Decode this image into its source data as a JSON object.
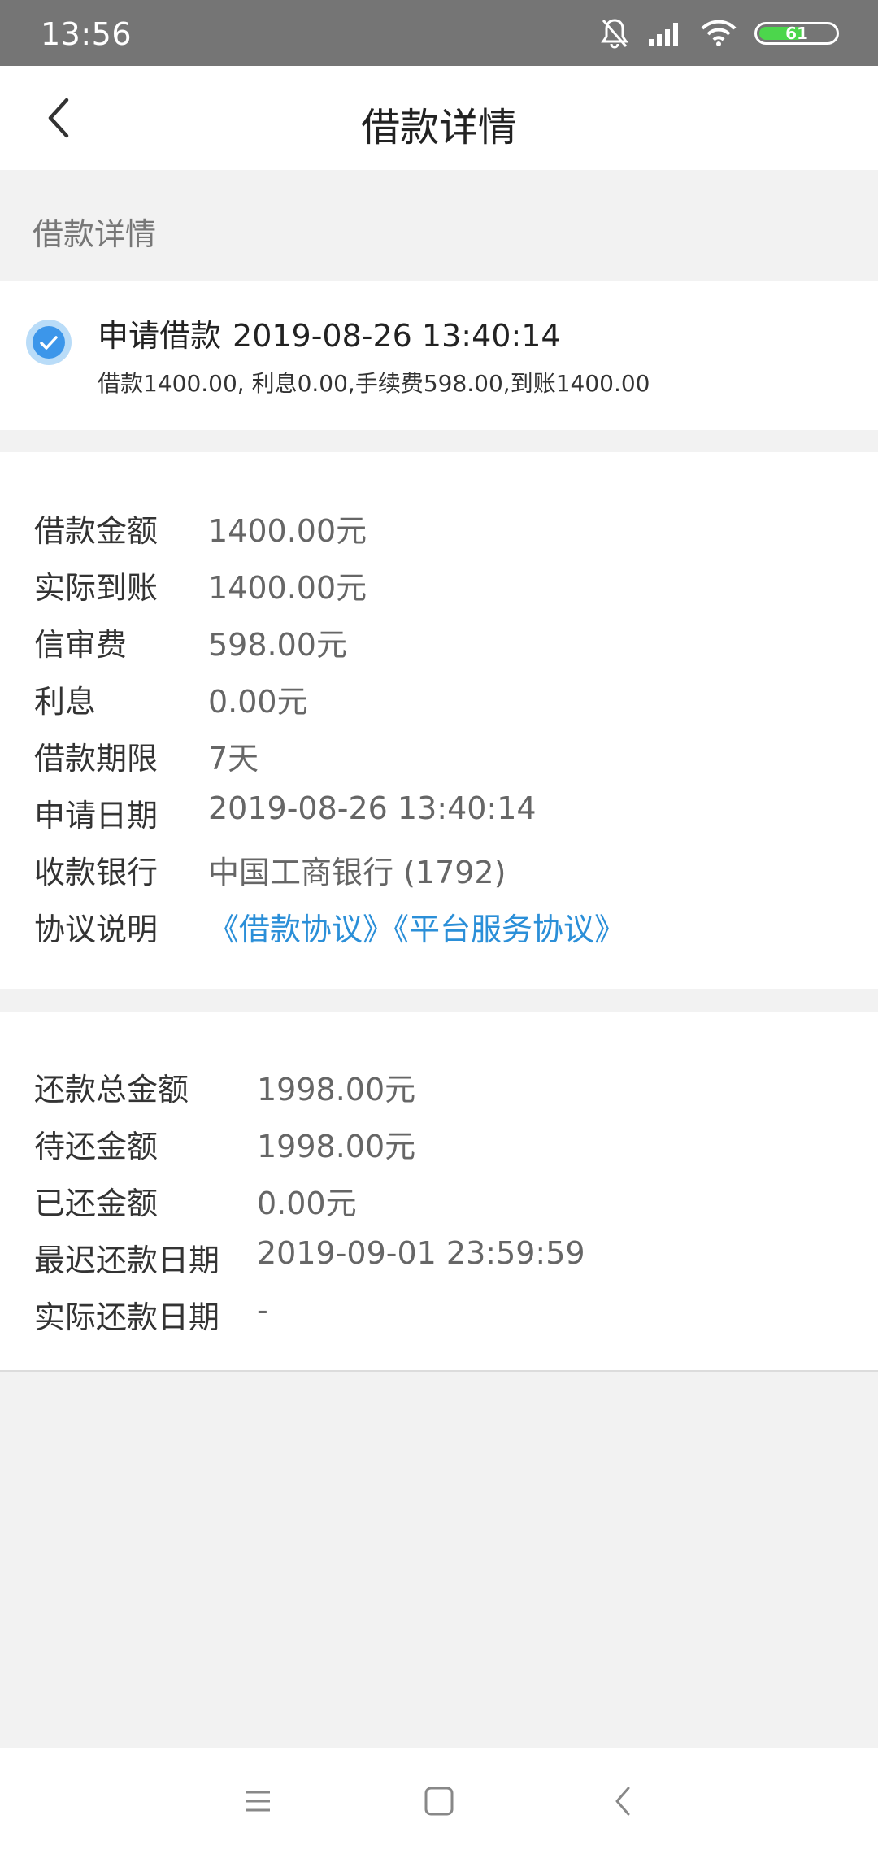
{
  "status_bar": {
    "time": "13:56",
    "battery": "61",
    "icons": [
      "bell-off-icon",
      "signal-icon",
      "wifi-icon",
      "battery-icon"
    ]
  },
  "header": {
    "title": "借款详情"
  },
  "section": {
    "label": "借款详情"
  },
  "application": {
    "title": "申请借款",
    "date": "2019-08-26 13:40:14",
    "summary": "借款1400.00, 利息0.00,手续费598.00,到账1400.00"
  },
  "loan_details": [
    {
      "key": "借款金额",
      "value": "1400.00元"
    },
    {
      "key": "实际到账",
      "value": "1400.00元"
    },
    {
      "key": "信审费",
      "value": "598.00元"
    },
    {
      "key": "利息",
      "value": "0.00元"
    },
    {
      "key": "借款期限",
      "value": "7天"
    },
    {
      "key": "申请日期",
      "value": "2019-08-26 13:40:14"
    },
    {
      "key": "收款银行",
      "value": "中国工商银行 (1792)"
    },
    {
      "key": "协议说明",
      "value": "《借款协议》《平台服务协议》"
    }
  ],
  "repayment_details": [
    {
      "key": "还款总金额",
      "value": "1998.00元"
    },
    {
      "key": "待还金额",
      "value": "1998.00元"
    },
    {
      "key": "已还金额",
      "value": "0.00元"
    },
    {
      "key": "最迟还款日期",
      "value": "2019-09-01 23:59:59"
    },
    {
      "key": "实际还款日期",
      "value": "-"
    }
  ],
  "colors": {
    "accent": "#3c96ea",
    "link": "#2b8fd8",
    "status_bar": "#757575",
    "background": "#f2f2f2"
  }
}
